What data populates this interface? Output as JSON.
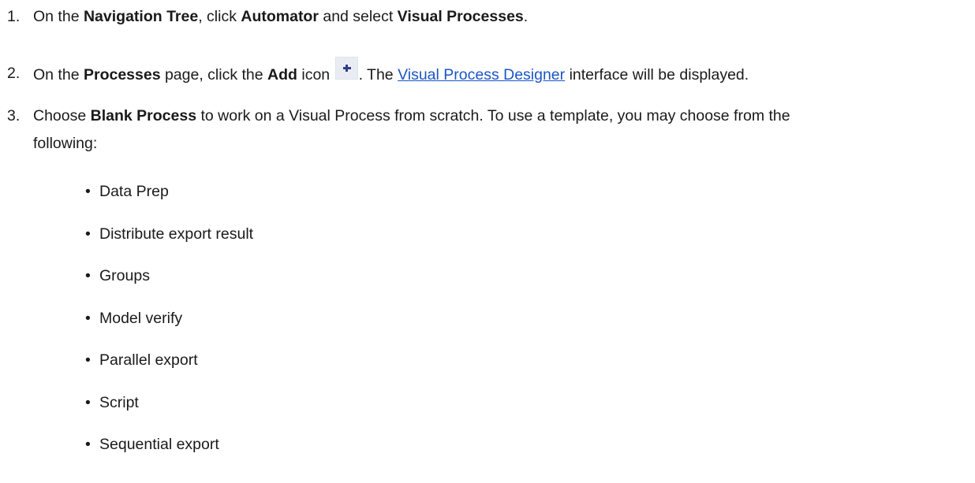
{
  "steps": [
    {
      "number": "1.",
      "parts": [
        "On the ",
        "Navigation Tree",
        ", click ",
        "Automator",
        " and select ",
        "Visual Processes",
        "."
      ]
    },
    {
      "number": "2.",
      "parts": [
        "On the ",
        "Processes",
        " page, click the ",
        "Add",
        " icon ",
        ". The ",
        "Visual Process Designer",
        " interface will be displayed."
      ],
      "icon": "add-icon"
    },
    {
      "number": "3.",
      "parts": [
        "Choose ",
        "Blank Process",
        " to work on a Visual Process from scratch. To use a template, you may choose from the",
        "following:"
      ]
    }
  ],
  "templates": [
    "Data Prep",
    "Distribute export result",
    "Groups",
    "Model verify",
    "Parallel export",
    "Script",
    "Sequential export"
  ],
  "colors": {
    "text": "#1a1a1a",
    "link": "#1a55c7",
    "icon_bg": "#e9edf3",
    "icon_plus": "#2f3e87"
  }
}
